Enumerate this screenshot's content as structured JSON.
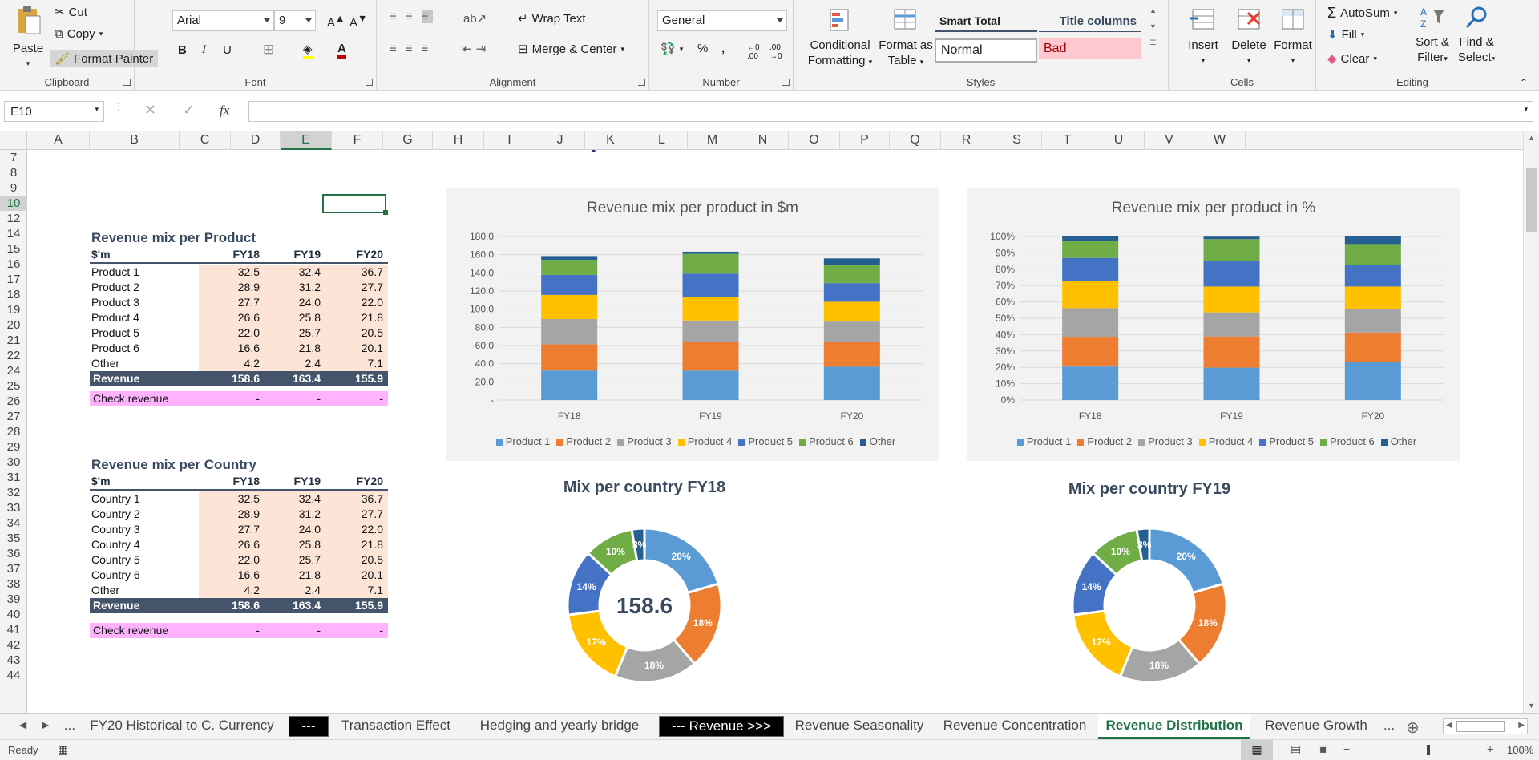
{
  "ribbon": {
    "clipboard": {
      "label": "Clipboard",
      "paste": "Paste",
      "cut": "Cut",
      "copy": "Copy",
      "format_painter": "Format Painter"
    },
    "font": {
      "label": "Font",
      "family": "Arial",
      "size": "9",
      "bold": "B",
      "italic": "I",
      "underline": "U"
    },
    "alignment": {
      "label": "Alignment",
      "wrap_text": "Wrap Text",
      "merge_center": "Merge & Center"
    },
    "number": {
      "label": "Number",
      "format": "General",
      "percent": "%",
      "comma": ","
    },
    "styles": {
      "label": "Styles",
      "conditional": [
        "Conditional",
        "Formatting"
      ],
      "format_table": [
        "Format as",
        "Table"
      ],
      "smart_total": "Smart Total",
      "title_columns": "Title columns",
      "normal": "Normal",
      "bad": "Bad"
    },
    "cells": {
      "label": "Cells",
      "insert": "Insert",
      "delete": "Delete",
      "format": "Format"
    },
    "editing": {
      "label": "Editing",
      "autosum": "AutoSum",
      "fill": "Fill",
      "clear": "Clear",
      "sort_filter": [
        "Sort &",
        "Filter"
      ],
      "find_select": [
        "Find &",
        "Select"
      ]
    }
  },
  "formula_bar": {
    "name_box": "E10",
    "formula": "",
    "fx": "fx"
  },
  "columns": [
    "A",
    "B",
    "C",
    "D",
    "E",
    "F",
    "G",
    "H",
    "I",
    "J",
    "K",
    "L",
    "M",
    "N",
    "O",
    "P",
    "Q",
    "R",
    "S",
    "T",
    "U",
    "V",
    "W"
  ],
  "rows": [
    "7",
    "8",
    "9",
    "10",
    "12",
    "14",
    "15",
    "16",
    "17",
    "18",
    "19",
    "20",
    "21",
    "22",
    "24",
    "25",
    "26",
    "27",
    "28",
    "29",
    "30",
    "31",
    "32",
    "33",
    "34",
    "35",
    "36",
    "37",
    "38",
    "39",
    "40",
    "41",
    "42",
    "43",
    "44"
  ],
  "selected_cell": "E10",
  "product_table": {
    "title": "Revenue mix per Product",
    "unit": "$'m",
    "years": [
      "FY18",
      "FY19",
      "FY20"
    ],
    "rows": [
      {
        "name": "Product 1",
        "v": [
          "32.5",
          "32.4",
          "36.7"
        ]
      },
      {
        "name": "Product 2",
        "v": [
          "28.9",
          "31.2",
          "27.7"
        ]
      },
      {
        "name": "Product 3",
        "v": [
          "27.7",
          "24.0",
          "22.0"
        ]
      },
      {
        "name": "Product 4",
        "v": [
          "26.6",
          "25.8",
          "21.8"
        ]
      },
      {
        "name": "Product 5",
        "v": [
          "22.0",
          "25.7",
          "20.5"
        ]
      },
      {
        "name": "Product 6",
        "v": [
          "16.6",
          "21.8",
          "20.1"
        ]
      },
      {
        "name": "Other",
        "v": [
          "4.2",
          "2.4",
          "7.1"
        ]
      }
    ],
    "total": {
      "name": "Revenue",
      "v": [
        "158.6",
        "163.4",
        "155.9"
      ]
    },
    "check": {
      "name": "Check revenue",
      "v": [
        "-",
        "-",
        "-"
      ]
    }
  },
  "country_table": {
    "title": "Revenue mix per Country",
    "unit": "$'m",
    "years": [
      "FY18",
      "FY19",
      "FY20"
    ],
    "rows": [
      {
        "name": "Country 1",
        "v": [
          "32.5",
          "32.4",
          "36.7"
        ]
      },
      {
        "name": "Country 2",
        "v": [
          "28.9",
          "31.2",
          "27.7"
        ]
      },
      {
        "name": "Country 3",
        "v": [
          "27.7",
          "24.0",
          "22.0"
        ]
      },
      {
        "name": "Country 4",
        "v": [
          "26.6",
          "25.8",
          "21.8"
        ]
      },
      {
        "name": "Country 5",
        "v": [
          "22.0",
          "25.7",
          "20.5"
        ]
      },
      {
        "name": "Country 6",
        "v": [
          "16.6",
          "21.8",
          "20.1"
        ]
      },
      {
        "name": "Other",
        "v": [
          "4.2",
          "2.4",
          "7.1"
        ]
      }
    ],
    "total": {
      "name": "Revenue",
      "v": [
        "158.6",
        "163.4",
        "155.9"
      ]
    },
    "check": {
      "name": "Check revenue",
      "v": [
        "-",
        "-",
        "-"
      ]
    }
  },
  "colors": {
    "Product 1": "#5b9bd5",
    "Product 2": "#ed7d31",
    "Product 3": "#a5a5a5",
    "Product 4": "#ffc000",
    "Product 5": "#4472c4",
    "Product 6": "#70ad47",
    "Other": "#255e91",
    "header_dark": "#44546a",
    "input_fill": "#fce4d6",
    "check_fill": "#ffb3ff",
    "excel_green": "#217346"
  },
  "chart_data": [
    {
      "type": "bar",
      "stacked": true,
      "title": "Revenue mix per product in $m",
      "categories": [
        "FY18",
        "FY19",
        "FY20"
      ],
      "ylim": [
        0,
        180
      ],
      "yticks": [
        "-",
        "20.0",
        "40.0",
        "60.0",
        "80.0",
        "100.0",
        "120.0",
        "140.0",
        "160.0",
        "180.0"
      ],
      "legend": "bottom",
      "series": [
        {
          "name": "Product 1",
          "values": [
            32.5,
            32.4,
            36.7
          ]
        },
        {
          "name": "Product 2",
          "values": [
            28.9,
            31.2,
            27.7
          ]
        },
        {
          "name": "Product 3",
          "values": [
            27.7,
            24.0,
            22.0
          ]
        },
        {
          "name": "Product 4",
          "values": [
            26.6,
            25.8,
            21.8
          ]
        },
        {
          "name": "Product 5",
          "values": [
            22.0,
            25.7,
            20.5
          ]
        },
        {
          "name": "Product 6",
          "values": [
            16.6,
            21.8,
            20.1
          ]
        },
        {
          "name": "Other",
          "values": [
            4.2,
            2.4,
            7.1
          ]
        }
      ]
    },
    {
      "type": "bar",
      "stacked": true,
      "percent": true,
      "title": "Revenue mix per product in %",
      "categories": [
        "FY18",
        "FY19",
        "FY20"
      ],
      "ylim": [
        0,
        100
      ],
      "yticks": [
        "0%",
        "10%",
        "20%",
        "30%",
        "40%",
        "50%",
        "60%",
        "70%",
        "80%",
        "90%",
        "100%"
      ],
      "legend": "bottom",
      "series": [
        {
          "name": "Product 1",
          "values": [
            20.5,
            19.8,
            23.5
          ]
        },
        {
          "name": "Product 2",
          "values": [
            18.2,
            19.1,
            17.8
          ]
        },
        {
          "name": "Product 3",
          "values": [
            17.5,
            14.7,
            14.1
          ]
        },
        {
          "name": "Product 4",
          "values": [
            16.8,
            15.8,
            14.0
          ]
        },
        {
          "name": "Product 5",
          "values": [
            13.9,
            15.7,
            13.1
          ]
        },
        {
          "name": "Product 6",
          "values": [
            10.5,
            13.3,
            12.9
          ]
        },
        {
          "name": "Other",
          "values": [
            2.6,
            1.5,
            4.6
          ]
        }
      ]
    },
    {
      "type": "pie",
      "donut": true,
      "title": "Mix per country FY18",
      "center_label": "158.6",
      "labels": [
        "20%",
        "18%",
        "18%",
        "17%",
        "14%",
        "10%",
        "3%"
      ],
      "values": [
        32.5,
        28.9,
        27.7,
        26.6,
        22.0,
        16.6,
        4.2
      ]
    },
    {
      "type": "pie",
      "donut": true,
      "title": "Mix per country FY19",
      "center_label": "",
      "labels": [
        "20%",
        "18%",
        "18%",
        "17%",
        "14%",
        "10%",
        "3%"
      ],
      "values": [
        32.5,
        28.9,
        27.7,
        26.6,
        22.0,
        16.6,
        4.2
      ]
    }
  ],
  "sheet_tabs": [
    "...",
    "FY20 Historical to C. Currency",
    "---",
    "Transaction Effect",
    "Hedging and yearly bridge",
    "--- Revenue >>>",
    "Revenue Seasonality",
    "Revenue Concentration",
    "Revenue Distribution",
    "Revenue Growth",
    "..."
  ],
  "active_tab": "Revenue Distribution",
  "status": {
    "ready": "Ready",
    "zoom": "100%"
  }
}
